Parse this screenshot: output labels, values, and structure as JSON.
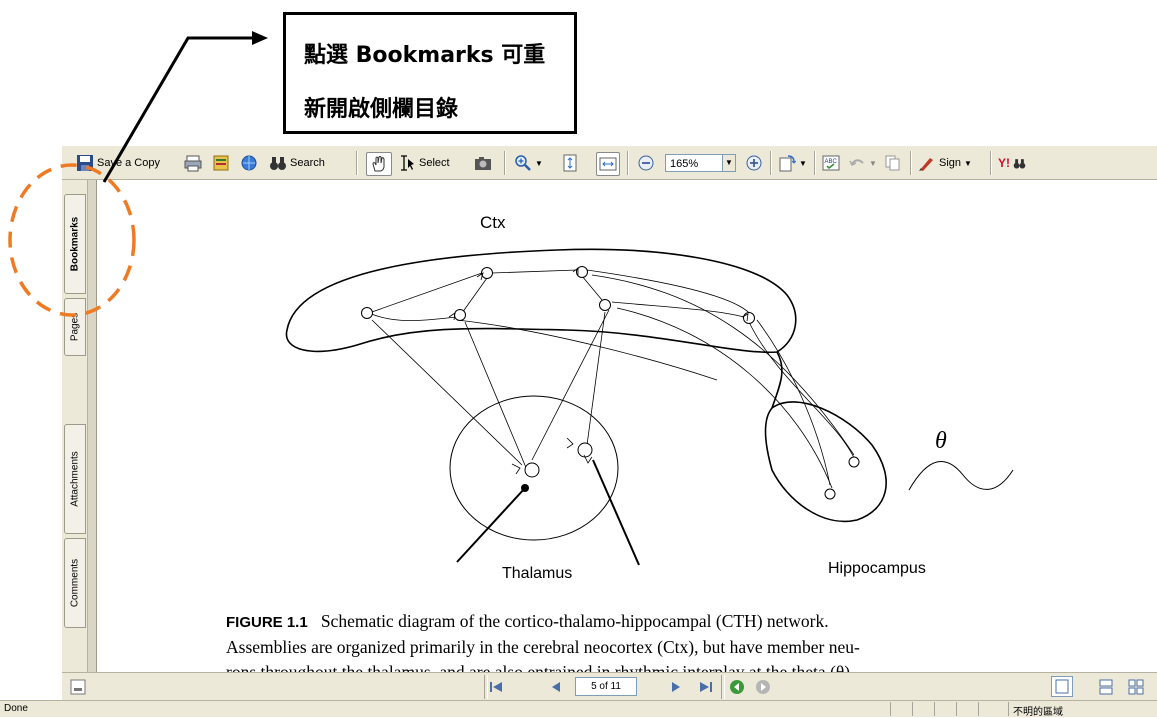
{
  "annotation": {
    "line1": "點選 Bookmarks 可重",
    "line2": "新開啟側欄目錄"
  },
  "toolbar": {
    "save_copy": "Save a Copy",
    "search": "Search",
    "select": "Select",
    "zoom_value": "165%",
    "sign": "Sign",
    "yahoo": "Y!"
  },
  "nav_tabs": {
    "bookmarks": "Bookmarks",
    "pages": "Pages",
    "attachments": "Attachments",
    "comments": "Comments"
  },
  "figure": {
    "ctx_label": "Ctx",
    "thalamus_label": "Thalamus",
    "hippocampus_label": "Hippocampus",
    "theta_label": "θ"
  },
  "caption": {
    "figure_num": "FIGURE 1.1",
    "line1": "Schematic diagram of the cortico-thalamo-hippocampal (CTH) network.",
    "line2": "Assemblies are organized primarily in the cerebral neocortex (Ctx), but have member neu-",
    "line3": "rons throughout the thalamus, and are also entrained in rhythmic interplay at the theta (θ)"
  },
  "pagination": {
    "page_display": "5 of 11"
  },
  "status": {
    "left": "Done",
    "zone": "不明的區域"
  },
  "colors": {
    "callout_circle": "#f07a22",
    "toolbar_bg": "#ece9d8"
  }
}
